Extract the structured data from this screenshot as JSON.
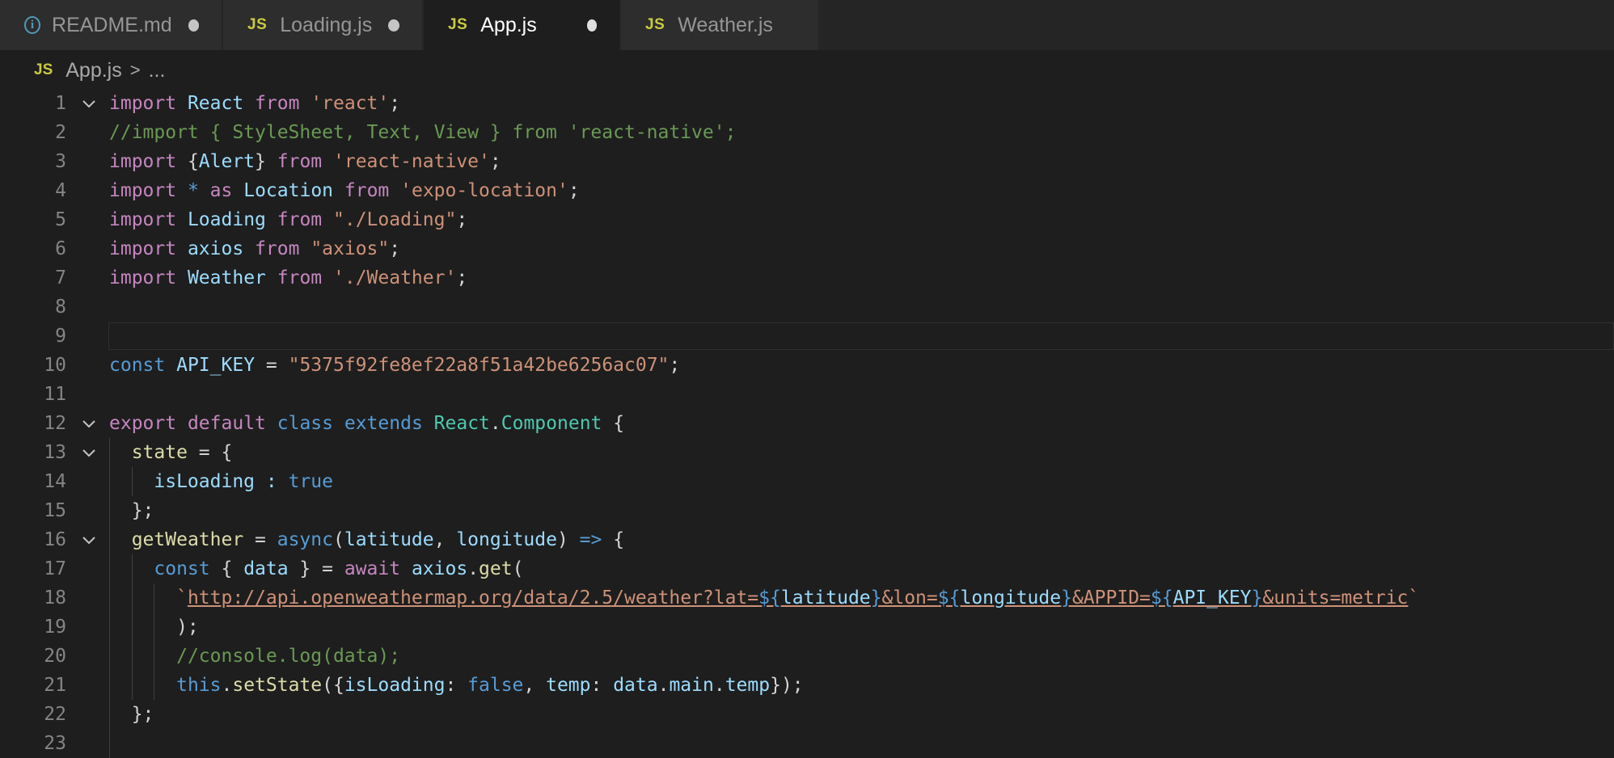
{
  "tabs": [
    {
      "label": "README.md",
      "icon": "info-icon",
      "dirty": true,
      "active": false
    },
    {
      "label": "Loading.js",
      "icon": "js-icon",
      "dirty": true,
      "active": false
    },
    {
      "label": "App.js",
      "icon": "js-icon",
      "dirty": true,
      "active": true
    },
    {
      "label": "Weather.js",
      "icon": "js-icon",
      "dirty": false,
      "active": false
    }
  ],
  "js_badge": "JS",
  "info_glyph": "i",
  "breadcrumb": {
    "file": "App.js",
    "separator": ">",
    "rest": "..."
  },
  "colors": {
    "keyword": "#c586c0",
    "storage": "#569cd6",
    "identifier": "#9cdcfe",
    "class": "#4ec9b0",
    "string": "#ce9178",
    "comment": "#6a9955",
    "function": "#dcdcaa"
  },
  "code": {
    "lines": [
      {
        "n": "1",
        "tokens": [
          [
            "kw",
            "import"
          ],
          [
            "pl",
            " "
          ],
          [
            "id",
            "React"
          ],
          [
            "pl",
            " "
          ],
          [
            "kw",
            "from"
          ],
          [
            "pl",
            " "
          ],
          [
            "str",
            "'react'"
          ],
          [
            "pl",
            ";"
          ]
        ]
      },
      {
        "n": "2",
        "tokens": [
          [
            "cmt",
            "//import { StyleSheet, Text, View } from 'react-native';"
          ]
        ]
      },
      {
        "n": "3",
        "tokens": [
          [
            "kw",
            "import"
          ],
          [
            "pl",
            " {"
          ],
          [
            "id",
            "Alert"
          ],
          [
            "pl",
            "} "
          ],
          [
            "kw",
            "from"
          ],
          [
            "pl",
            " "
          ],
          [
            "str",
            "'react-native'"
          ],
          [
            "pl",
            ";"
          ]
        ]
      },
      {
        "n": "4",
        "tokens": [
          [
            "kw",
            "import"
          ],
          [
            "pl",
            " "
          ],
          [
            "kwb",
            "*"
          ],
          [
            "pl",
            " "
          ],
          [
            "kw",
            "as"
          ],
          [
            "pl",
            " "
          ],
          [
            "id",
            "Location"
          ],
          [
            "pl",
            " "
          ],
          [
            "kw",
            "from"
          ],
          [
            "pl",
            " "
          ],
          [
            "str",
            "'expo-location'"
          ],
          [
            "pl",
            ";"
          ]
        ]
      },
      {
        "n": "5",
        "tokens": [
          [
            "kw",
            "import"
          ],
          [
            "pl",
            " "
          ],
          [
            "id",
            "Loading"
          ],
          [
            "pl",
            " "
          ],
          [
            "kw",
            "from"
          ],
          [
            "pl",
            " "
          ],
          [
            "str",
            "\"./Loading\""
          ],
          [
            "pl",
            ";"
          ]
        ]
      },
      {
        "n": "6",
        "tokens": [
          [
            "kw",
            "import"
          ],
          [
            "pl",
            " "
          ],
          [
            "id",
            "axios"
          ],
          [
            "pl",
            " "
          ],
          [
            "kw",
            "from"
          ],
          [
            "pl",
            " "
          ],
          [
            "str",
            "\"axios\""
          ],
          [
            "pl",
            ";"
          ]
        ]
      },
      {
        "n": "7",
        "tokens": [
          [
            "kw",
            "import"
          ],
          [
            "pl",
            " "
          ],
          [
            "id",
            "Weather"
          ],
          [
            "pl",
            " "
          ],
          [
            "kw",
            "from"
          ],
          [
            "pl",
            " "
          ],
          [
            "str",
            "'./Weather'"
          ],
          [
            "pl",
            ";"
          ]
        ]
      },
      {
        "n": "8",
        "tokens": []
      },
      {
        "n": "9",
        "tokens": []
      },
      {
        "n": "10",
        "tokens": [
          [
            "kwb",
            "const"
          ],
          [
            "pl",
            " "
          ],
          [
            "id",
            "API_KEY"
          ],
          [
            "pl",
            " = "
          ],
          [
            "str",
            "\"5375f92fe8ef22a8f51a42be6256ac07\""
          ],
          [
            "pl",
            ";"
          ]
        ]
      },
      {
        "n": "11",
        "tokens": []
      },
      {
        "n": "12",
        "tokens": [
          [
            "kw",
            "export"
          ],
          [
            "pl",
            " "
          ],
          [
            "kw",
            "default"
          ],
          [
            "pl",
            " "
          ],
          [
            "kwb",
            "class"
          ],
          [
            "pl",
            " "
          ],
          [
            "kwb",
            "extends"
          ],
          [
            "pl",
            " "
          ],
          [
            "cls",
            "React"
          ],
          [
            "pl",
            "."
          ],
          [
            "cls",
            "Component"
          ],
          [
            "pl",
            " {"
          ]
        ]
      },
      {
        "n": "13",
        "tokens": [
          [
            "pl",
            "  "
          ],
          [
            "fn",
            "state"
          ],
          [
            "pl",
            " = {"
          ]
        ]
      },
      {
        "n": "14",
        "tokens": [
          [
            "pl",
            "    "
          ],
          [
            "id",
            "isLoading"
          ],
          [
            "pl",
            " "
          ],
          [
            "id",
            ":"
          ],
          [
            "pl",
            " "
          ],
          [
            "kwb",
            "true"
          ]
        ]
      },
      {
        "n": "15",
        "tokens": [
          [
            "pl",
            "  };"
          ]
        ]
      },
      {
        "n": "16",
        "tokens": [
          [
            "pl",
            "  "
          ],
          [
            "fn",
            "getWeather"
          ],
          [
            "pl",
            " = "
          ],
          [
            "kwb",
            "async"
          ],
          [
            "pl",
            "("
          ],
          [
            "id",
            "latitude"
          ],
          [
            "pl",
            ", "
          ],
          [
            "id",
            "longitude"
          ],
          [
            "pl",
            ") "
          ],
          [
            "kwb",
            "=>"
          ],
          [
            "pl",
            " {"
          ]
        ]
      },
      {
        "n": "17",
        "tokens": [
          [
            "pl",
            "    "
          ],
          [
            "kwb",
            "const"
          ],
          [
            "pl",
            " { "
          ],
          [
            "id",
            "data"
          ],
          [
            "pl",
            " } = "
          ],
          [
            "kw",
            "await"
          ],
          [
            "pl",
            " "
          ],
          [
            "id",
            "axios"
          ],
          [
            "pl",
            "."
          ],
          [
            "fn",
            "get"
          ],
          [
            "pl",
            "("
          ]
        ]
      },
      {
        "n": "18",
        "tokens": [
          [
            "pl",
            "      "
          ],
          [
            "str",
            "`"
          ],
          [
            "url",
            "http://api.openweathermap.org/data/2.5/weather?lat="
          ],
          [
            "urlt",
            "${"
          ],
          [
            "urlid",
            "latitude"
          ],
          [
            "urlt",
            "}"
          ],
          [
            "url",
            "&lon="
          ],
          [
            "urlt",
            "${"
          ],
          [
            "urlid",
            "longitude"
          ],
          [
            "urlt",
            "}"
          ],
          [
            "url",
            "&APPID="
          ],
          [
            "urlt",
            "${"
          ],
          [
            "urlid",
            "API_KEY"
          ],
          [
            "urlt",
            "}"
          ],
          [
            "url",
            "&units=metric"
          ],
          [
            "str",
            "`"
          ]
        ]
      },
      {
        "n": "19",
        "tokens": [
          [
            "pl",
            "      );"
          ]
        ]
      },
      {
        "n": "20",
        "tokens": [
          [
            "pl",
            "      "
          ],
          [
            "cmt",
            "//console.log(data);"
          ]
        ]
      },
      {
        "n": "21",
        "tokens": [
          [
            "pl",
            "      "
          ],
          [
            "kwb",
            "this"
          ],
          [
            "pl",
            "."
          ],
          [
            "fn",
            "setState"
          ],
          [
            "pl",
            "({"
          ],
          [
            "id",
            "isLoading"
          ],
          [
            "pl",
            ": "
          ],
          [
            "kwb",
            "false"
          ],
          [
            "pl",
            ", "
          ],
          [
            "id",
            "temp"
          ],
          [
            "pl",
            ": "
          ],
          [
            "id",
            "data"
          ],
          [
            "pl",
            "."
          ],
          [
            "id",
            "main"
          ],
          [
            "pl",
            "."
          ],
          [
            "id",
            "temp"
          ],
          [
            "pl",
            "});"
          ]
        ]
      },
      {
        "n": "22",
        "tokens": [
          [
            "pl",
            "  };"
          ]
        ]
      },
      {
        "n": "23",
        "tokens": []
      }
    ],
    "folds": [
      "1",
      "12",
      "13",
      "16"
    ],
    "current_line": "9"
  }
}
